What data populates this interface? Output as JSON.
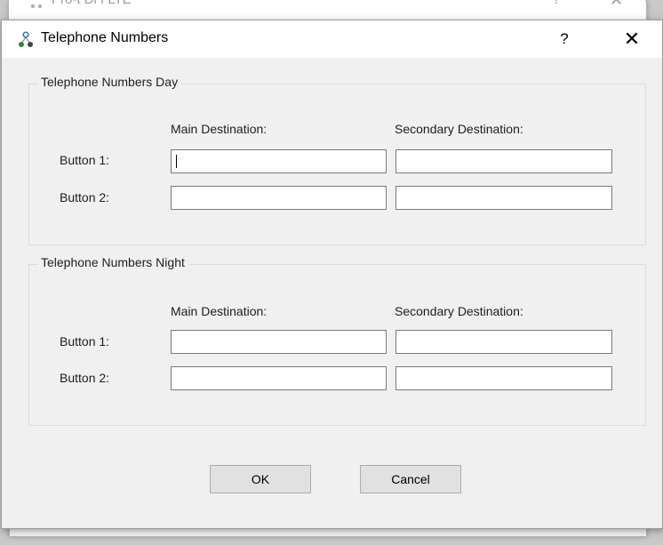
{
  "background_window": {
    "title": "Pro-t Di I LTE",
    "help_glyph": "?",
    "close_glyph": "✕"
  },
  "dialog": {
    "title": "Telephone Numbers",
    "help_glyph": "?",
    "close_glyph": "✕",
    "icon": "app-nodes-icon"
  },
  "day_group": {
    "legend": "Telephone Numbers Day",
    "main_header": "Main Destination:",
    "secondary_header": "Secondary Destination:",
    "rows": [
      {
        "label": "Button 1:",
        "main_value": "",
        "secondary_value": ""
      },
      {
        "label": "Button 2:",
        "main_value": "",
        "secondary_value": ""
      }
    ]
  },
  "night_group": {
    "legend": "Telephone Numbers Night",
    "main_header": "Main Destination:",
    "secondary_header": "Secondary Destination:",
    "rows": [
      {
        "label": "Button 1:",
        "main_value": "",
        "secondary_value": ""
      },
      {
        "label": "Button 2:",
        "main_value": "",
        "secondary_value": ""
      }
    ]
  },
  "buttons": {
    "ok": "OK",
    "cancel": "Cancel"
  },
  "colors": {
    "dialog_bg": "#f0f0f0",
    "titlebar_bg": "#ffffff",
    "button_bg": "#e1e1e1",
    "field_border": "#7a7a7a",
    "group_border": "#dcdcdc"
  }
}
